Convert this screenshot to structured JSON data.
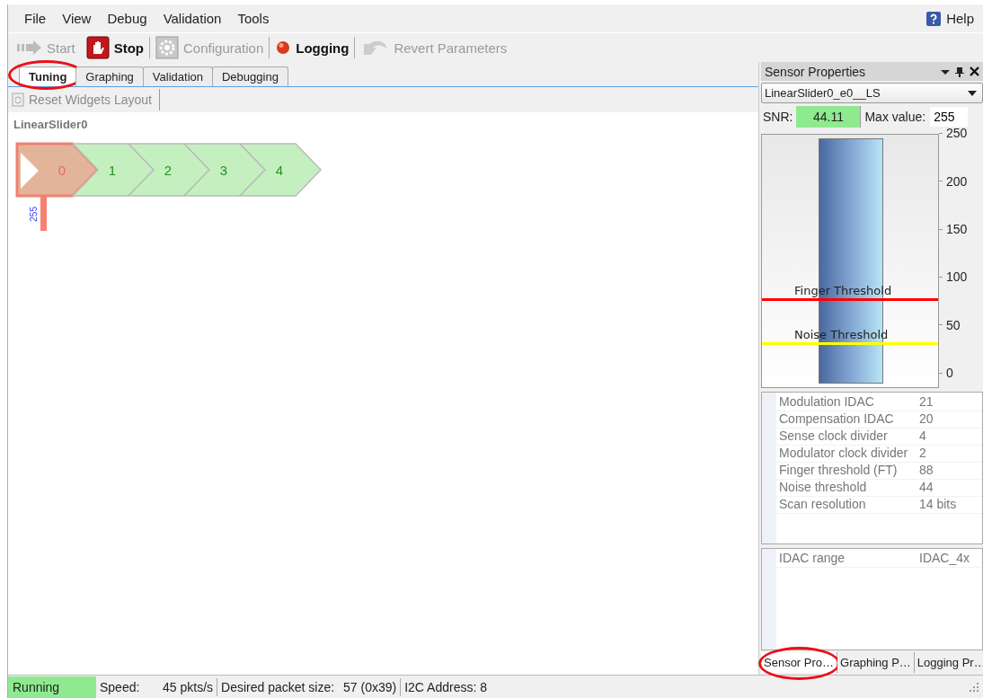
{
  "menu": [
    {
      "label": "File"
    },
    {
      "label": "View"
    },
    {
      "label": "Debug"
    },
    {
      "label": "Validation"
    },
    {
      "label": "Tools"
    }
  ],
  "help": "Help",
  "toolbar": [
    {
      "kind": "start",
      "label": "Start",
      "disabled": true
    },
    {
      "kind": "stop",
      "label": "Stop",
      "disabled": false
    },
    {
      "kind": "config",
      "label": "Configuration",
      "disabled": true
    },
    {
      "kind": "logging",
      "label": "Logging",
      "disabled": false
    },
    {
      "kind": "revert",
      "label": "Revert Parameters",
      "disabled": true
    }
  ],
  "tabs": [
    {
      "label": "Tuning",
      "selected": true,
      "circled": true
    },
    {
      "label": "Graphing",
      "selected": false,
      "circled": false
    },
    {
      "label": "Validation",
      "selected": false,
      "circled": false
    },
    {
      "label": "Debugging",
      "selected": false,
      "circled": false
    }
  ],
  "reset_button": "Reset Widgets Layout",
  "widget": {
    "title": "LinearSlider0",
    "marker_reading": "255",
    "segments": [
      {
        "label": "0",
        "selected": true
      },
      {
        "label": "1",
        "selected": false
      },
      {
        "label": "2",
        "selected": false
      },
      {
        "label": "3",
        "selected": false
      },
      {
        "label": "4",
        "selected": false
      }
    ]
  },
  "sensor_panel": {
    "title": "Sensor Properties",
    "sensor": "LinearSlider0_e0__LS",
    "snr_label": "SNR:",
    "snr": "44.11",
    "max_label": "Max value:",
    "max_value": "255",
    "meter": {
      "level": 1.0,
      "scale": [
        "250",
        "200",
        "150",
        "100",
        "50",
        "0"
      ],
      "thresholds": [
        {
          "label": "Finger Threshold",
          "level": 0.345,
          "color": "#ff0000"
        },
        {
          "label": "Noise Threshold",
          "level": 0.173,
          "color": "#ffff00"
        }
      ]
    },
    "properties": [
      {
        "name": "Modulation IDAC",
        "value": "21"
      },
      {
        "name": "Compensation IDAC",
        "value": "20"
      },
      {
        "name": "Sense clock divider",
        "value": "4"
      },
      {
        "name": "Modulator clock divider",
        "value": "2"
      },
      {
        "name": "Finger threshold (FT)",
        "value": "88"
      },
      {
        "name": "Noise threshold",
        "value": "44"
      },
      {
        "name": "Scan resolution",
        "value": "14 bits"
      }
    ],
    "properties_2": [
      {
        "name": "IDAC range",
        "value": "IDAC_4x"
      }
    ],
    "bottom_tabs": [
      {
        "label": "Sensor Pro…",
        "selected": true,
        "circled": true
      },
      {
        "label": "Graphing P…",
        "selected": false,
        "circled": false
      },
      {
        "label": "Logging Pr…",
        "selected": false,
        "circled": false
      }
    ]
  },
  "status_bar": {
    "state": "Running",
    "speed_label": "Speed:",
    "speed": "45 pkts/s",
    "packet_label": "Desired packet size:",
    "packet": "57 (0x39)",
    "address": "I2C Address: 8"
  }
}
